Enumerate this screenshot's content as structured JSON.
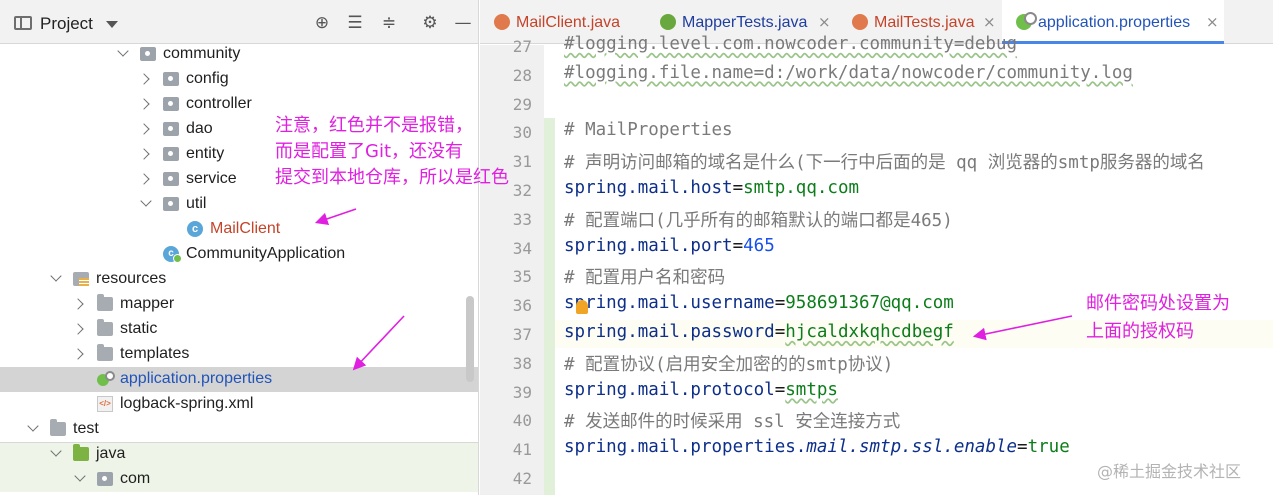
{
  "project_panel": {
    "title": "Project",
    "tools": [
      "crosshair-icon",
      "expand-all-icon",
      "collapse-all-icon",
      "gear-icon",
      "minimize-icon"
    ],
    "tree": [
      {
        "label": "community",
        "icon": "package-icon",
        "expanded": true
      },
      {
        "label": "config",
        "icon": "package-icon",
        "expanded": false
      },
      {
        "label": "controller",
        "icon": "package-icon",
        "expanded": false
      },
      {
        "label": "dao",
        "icon": "package-icon",
        "expanded": false
      },
      {
        "label": "entity",
        "icon": "package-icon",
        "expanded": false
      },
      {
        "label": "service",
        "icon": "package-icon",
        "expanded": false
      },
      {
        "label": "util",
        "icon": "package-icon",
        "expanded": true
      },
      {
        "label": "MailClient",
        "icon": "java-class-icon",
        "color": "#c4442a"
      },
      {
        "label": "CommunityApplication",
        "icon": "spring-boot-class-icon"
      },
      {
        "label": "resources",
        "icon": "resources-folder-icon",
        "expanded": true
      },
      {
        "label": "mapper",
        "icon": "folder-icon",
        "expanded": false
      },
      {
        "label": "static",
        "icon": "folder-icon",
        "expanded": false
      },
      {
        "label": "templates",
        "icon": "folder-icon",
        "expanded": false
      },
      {
        "label": "application.properties",
        "icon": "spring-properties-icon",
        "selected": true,
        "color": "#2254b8"
      },
      {
        "label": "logback-spring.xml",
        "icon": "xml-file-icon"
      },
      {
        "label": "test",
        "icon": "folder-icon",
        "expanded": true
      },
      {
        "label": "java",
        "icon": "test-folder-icon",
        "expanded": true
      },
      {
        "label": "com",
        "icon": "package-icon",
        "expanded": true
      }
    ]
  },
  "tabs": [
    {
      "label": "MailClient.java",
      "color": "#c4442a",
      "icon": "java-class-icon"
    },
    {
      "label": "MapperTests.java",
      "color": "#1f3e9e",
      "icon": "java-test-class-icon"
    },
    {
      "label": "MailTests.java",
      "color": "#c4442a",
      "icon": "java-test-class-icon"
    },
    {
      "label": "application.properties",
      "color": "#2254b8",
      "icon": "spring-properties-icon",
      "active": true
    }
  ],
  "tab_close_glyph": "×",
  "editor": {
    "lines": [
      {
        "n": "27",
        "text": "#logging.level.com.nowcoder.community=debug",
        "kind": "comment"
      },
      {
        "n": "28",
        "text": "#logging.file.name=d:/work/data/nowcoder/community.log",
        "kind": "comment"
      },
      {
        "n": "29",
        "text": "",
        "kind": "blank"
      },
      {
        "n": "30",
        "text": "# MailProperties",
        "kind": "comment"
      },
      {
        "n": "31",
        "text": "# 声明访问邮箱的域名是什么(下一行中后面的是 qq 浏览器的smtp服务器的域名",
        "kind": "comment"
      },
      {
        "n": "32",
        "key": "spring.mail.host",
        "value": "smtp.qq.com",
        "kind": "prop"
      },
      {
        "n": "33",
        "text": "# 配置端口(几乎所有的邮箱默认的端口都是465)",
        "kind": "comment"
      },
      {
        "n": "34",
        "key": "spring.mail.port",
        "value": "465",
        "kind": "prop-num"
      },
      {
        "n": "35",
        "text": "# 配置用户名和密码",
        "kind": "comment"
      },
      {
        "n": "36",
        "key": "spring.mail.username",
        "value": "958691367@qq.com",
        "kind": "prop"
      },
      {
        "n": "37",
        "key": "spring.mail.password",
        "value": "hjcaldxkqhcdbegf",
        "kind": "prop"
      },
      {
        "n": "38",
        "text": "# 配置协议(启用安全加密的的smtp协议)",
        "kind": "comment"
      },
      {
        "n": "39",
        "key": "spring.mail.protocol",
        "value": "smtps",
        "kind": "prop"
      },
      {
        "n": "40",
        "text": "# 发送邮件的时候采用 ssl 安全连接方式",
        "kind": "comment"
      },
      {
        "n": "41",
        "key_plain": "spring.mail.properties.",
        "key_italic": "mail.smtp.ssl.enable",
        "value": "true",
        "kind": "prop-italic"
      },
      {
        "n": "42",
        "text": "",
        "kind": "blank"
      }
    ]
  },
  "annotations": {
    "left_note": [
      "注意，红色并不是报错，",
      "而是配置了Git，还没有",
      "提交到本地仓库，所以是红色"
    ],
    "right_note": [
      "邮件密码处设置为",
      "上面的授权码"
    ],
    "color": "#e020e0"
  },
  "watermark": "@稀土掘金技术社区"
}
